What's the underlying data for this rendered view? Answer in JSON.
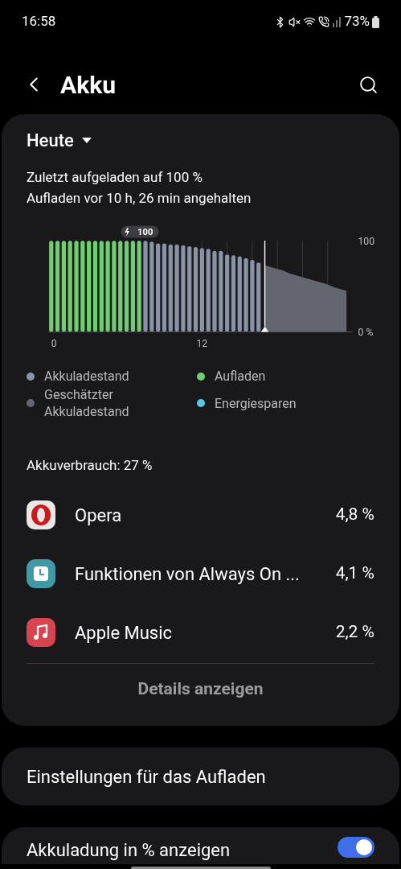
{
  "status_bar": {
    "time": "16:58",
    "battery": "73%"
  },
  "header": {
    "title": "Akku"
  },
  "usage_card": {
    "period": "Heute",
    "info_lines": [
      "Zuletzt aufgeladen auf 100 %",
      "Aufladen vor 10 h, 26 min angehalten"
    ],
    "chart_data": {
      "type": "bar",
      "stacked": true,
      "x": [
        0,
        0.5,
        1,
        1.5,
        2,
        2.5,
        3,
        3.5,
        4,
        4.5,
        5,
        5.5,
        6,
        6.5,
        7,
        7.5,
        8,
        8.5,
        9,
        9.5,
        10,
        10.5,
        11,
        11.5,
        12,
        12.5,
        13,
        13.5,
        14,
        14.5,
        15,
        15.5,
        16,
        16.5,
        17,
        17.5,
        18,
        18.5,
        19,
        19.5,
        20,
        20.5,
        21,
        21.5,
        22,
        22.5,
        23,
        23.5
      ],
      "xticks": [
        0,
        12
      ],
      "ylim": [
        0,
        100
      ],
      "yticks": [
        {
          "value": 0,
          "label": "0 %"
        },
        {
          "value": 100,
          "label": "100"
        }
      ],
      "series": [
        {
          "name": "Aufladen",
          "color": "#6fcf6f",
          "values": [
            100,
            100,
            100,
            100,
            100,
            100,
            100,
            100,
            100,
            100,
            100,
            100,
            100,
            100,
            100,
            null,
            null,
            null,
            null,
            null,
            null,
            null,
            null,
            null,
            null,
            null,
            null,
            null,
            null,
            null,
            null,
            null,
            null,
            null,
            null,
            null,
            null,
            null,
            null,
            null,
            null,
            null,
            null,
            null,
            null,
            null,
            null,
            null
          ]
        },
        {
          "name": "Akkuladestand",
          "color": "#8a92a6",
          "values": [
            null,
            null,
            null,
            null,
            null,
            null,
            null,
            null,
            null,
            null,
            null,
            null,
            null,
            null,
            null,
            100,
            99,
            97,
            97,
            96,
            96,
            95,
            94,
            93,
            92,
            91,
            89,
            89,
            85,
            84,
            83,
            81,
            79,
            76,
            null,
            null,
            null,
            null,
            null,
            null,
            null,
            null,
            null,
            null,
            null,
            null,
            null,
            null
          ]
        },
        {
          "name": "Geschätzter Akkuladestand",
          "type": "area",
          "color": "#63666e",
          "values": [
            null,
            null,
            null,
            null,
            null,
            null,
            null,
            null,
            null,
            null,
            null,
            null,
            null,
            null,
            null,
            null,
            null,
            null,
            null,
            null,
            null,
            null,
            null,
            null,
            null,
            null,
            null,
            null,
            null,
            null,
            null,
            null,
            null,
            null,
            73,
            71,
            69,
            67,
            64,
            62,
            60,
            58,
            56,
            54,
            52,
            49,
            47,
            45
          ]
        }
      ],
      "xlim": [
        0,
        24
      ],
      "ref_lines": [
        {
          "axis": "x",
          "value": 17
        }
      ],
      "annotations": [
        {
          "x": 7,
          "y": 100,
          "text": "100"
        }
      ]
    },
    "extra_legend": [
      {
        "label": "Energiesparen",
        "color": "#5ac8e0"
      }
    ],
    "usage_title": "Akkuverbrauch: 27 %",
    "apps": [
      {
        "kind": "opera",
        "name": "Opera",
        "share": "4,8 %"
      },
      {
        "kind": "clock",
        "name": "Funktionen von Always On ...",
        "share": "4,1 %"
      },
      {
        "kind": "music",
        "name": "Apple Music",
        "share": "2,2 %"
      }
    ],
    "details_button": "Details anzeigen"
  },
  "settings": [
    {
      "label": "Einstellungen für das Aufladen"
    },
    {
      "label": "Akkuladung in % anzeigen",
      "toggle": true
    }
  ]
}
